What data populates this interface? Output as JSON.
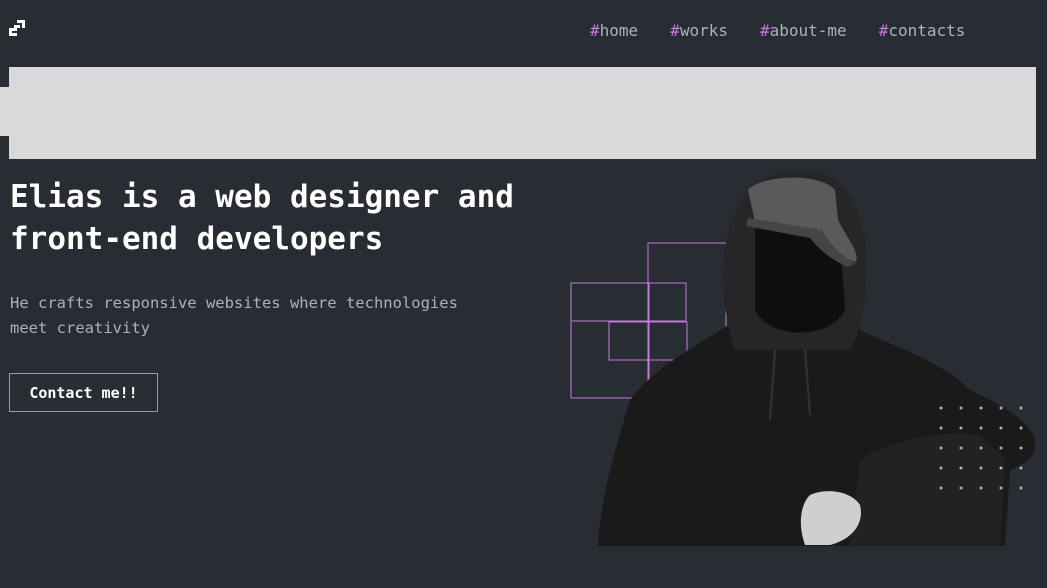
{
  "header": {
    "logo_icon": "pixel-logo-icon",
    "nav": [
      {
        "hash": "#",
        "label": "home"
      },
      {
        "hash": "#",
        "label": "works"
      },
      {
        "hash": "#",
        "label": "about-me"
      },
      {
        "hash": "#",
        "label": "contacts"
      }
    ]
  },
  "hero": {
    "headline_line1": "Elias is a web designer and",
    "headline_line2": "front-end developers",
    "subtitle_line1": "He crafts responsive websites where technologies",
    "subtitle_line2": "meet creativity",
    "cta_label": "Contact me!!"
  },
  "colors": {
    "background": "#282c33",
    "accent": "#c778dd",
    "text": "#abb2bf",
    "heading": "#ffffff",
    "banner": "#d9d9d9"
  },
  "decor": {
    "image_subject": "person-in-black-hoodie-and-cap",
    "shape": "outline-squares",
    "dots": "dot-grid"
  }
}
